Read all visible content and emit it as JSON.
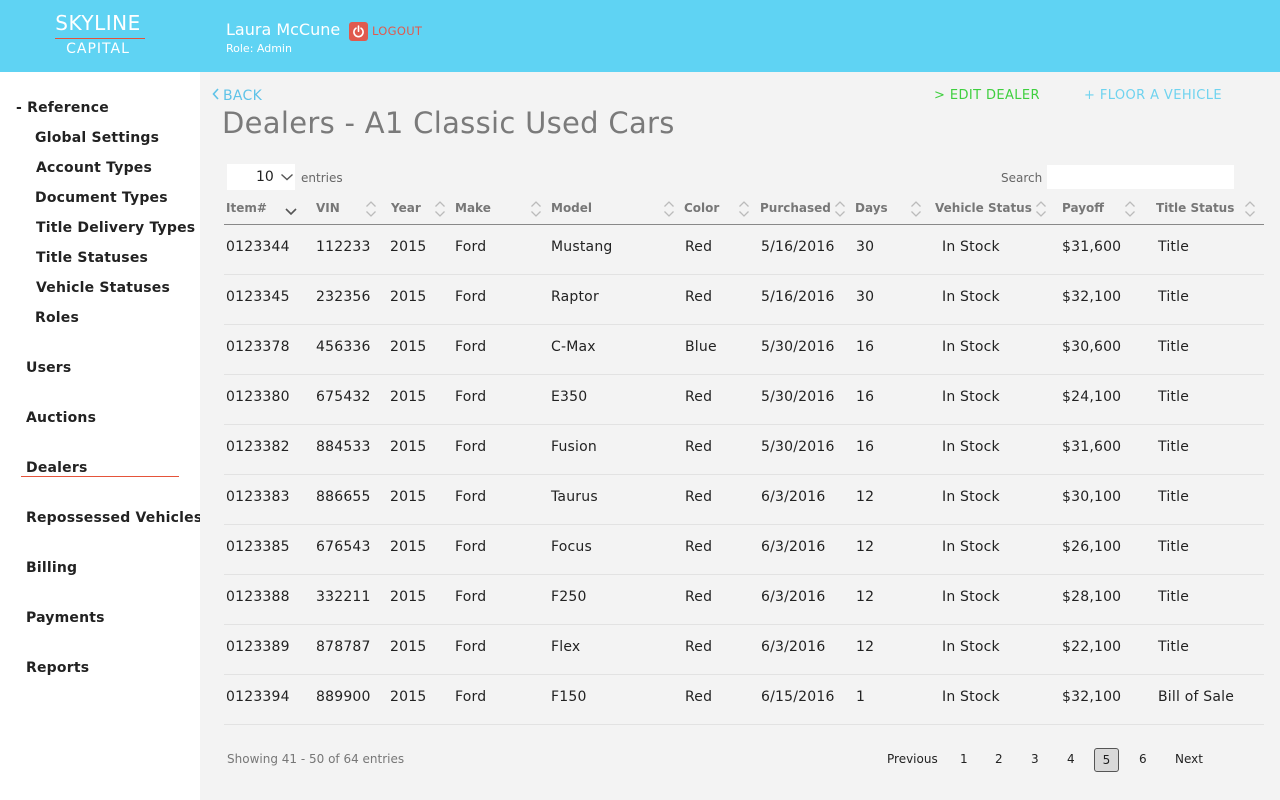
{
  "header": {
    "logo_top": "SKYLINE",
    "logo_bottom": "CAPITAL",
    "user_name": "Laura McCune",
    "user_role": "Role: Admin",
    "logout_label": "LOGOUT"
  },
  "sidebar": {
    "reference_label": "- Reference",
    "reference_items": [
      "Global Settings",
      "Account Types",
      "Document Types",
      "Title Delivery Types",
      "Title Statuses",
      "Vehicle Statuses",
      "Roles"
    ],
    "items": [
      "Users",
      "Auctions",
      "Dealers",
      "Repossessed Vehicles",
      "Billing",
      "Payments",
      "Reports"
    ],
    "active_item": "Dealers"
  },
  "main": {
    "back_label": "BACK",
    "edit_dealer_label": "> EDIT DEALER",
    "floor_vehicle_label": "+ FLOOR A VEHICLE",
    "title": "Dealers - A1 Classic Used Cars",
    "entries_value": "10",
    "entries_label": "entries",
    "search_label": "Search",
    "search_value": ""
  },
  "table": {
    "columns": [
      "Item#",
      "VIN",
      "Year",
      "Make",
      "Model",
      "Color",
      "Purchased",
      "Days",
      "Vehicle Status",
      "Payoff",
      "Title Status"
    ],
    "rows": [
      [
        "0123344",
        "112233",
        "2015",
        "Ford",
        "Mustang",
        "Red",
        "5/16/2016",
        "30",
        "In Stock",
        "$31,600",
        "Title"
      ],
      [
        "0123345",
        "232356",
        "2015",
        "Ford",
        "Raptor",
        "Red",
        "5/16/2016",
        "30",
        "In Stock",
        "$32,100",
        "Title"
      ],
      [
        "0123378",
        "456336",
        "2015",
        "Ford",
        "C-Max",
        "Blue",
        "5/30/2016",
        "16",
        "In Stock",
        "$30,600",
        "Title"
      ],
      [
        "0123380",
        "675432",
        "2015",
        "Ford",
        "E350",
        "Red",
        "5/30/2016",
        "16",
        "In Stock",
        "$24,100",
        "Title"
      ],
      [
        "0123382",
        "884533",
        "2015",
        "Ford",
        "Fusion",
        "Red",
        "5/30/2016",
        "16",
        "In Stock",
        "$31,600",
        "Title"
      ],
      [
        "0123383",
        "886655",
        "2015",
        "Ford",
        "Taurus",
        "Red",
        "6/3/2016",
        "12",
        "In Stock",
        "$30,100",
        "Title"
      ],
      [
        "0123385",
        "676543",
        "2015",
        "Ford",
        "Focus",
        "Red",
        "6/3/2016",
        "12",
        "In Stock",
        "$26,100",
        "Title"
      ],
      [
        "0123388",
        "332211",
        "2015",
        "Ford",
        "F250",
        "Red",
        "6/3/2016",
        "12",
        "In Stock",
        "$28,100",
        "Title"
      ],
      [
        "0123389",
        "878787",
        "2015",
        "Ford",
        "Flex",
        "Red",
        "6/3/2016",
        "12",
        "In Stock",
        "$22,100",
        "Title"
      ],
      [
        "0123394",
        "889900",
        "2015",
        "Ford",
        "F150",
        "Red",
        "6/15/2016",
        "1",
        "In Stock",
        "$32,100",
        "Bill of Sale"
      ]
    ]
  },
  "footer": {
    "showing": "Showing 41 - 50 of 64 entries",
    "previous": "Previous",
    "pages": [
      "1",
      "2",
      "3",
      "4",
      "5",
      "6"
    ],
    "current_page": "5",
    "next": "Next"
  },
  "colors": {
    "header_bg": "#5fd3f3",
    "accent_red": "#e5533a",
    "logout_red": "#e05a4e",
    "back_blue": "#5fc3e8",
    "edit_green": "#3fcf3f",
    "floor_blue": "#6fd3ef"
  },
  "icons": {
    "logout": "power-icon",
    "back": "chevron-left-icon",
    "select": "chevron-down-icon",
    "sort": "sort-icon",
    "sort_active": "sort-desc-icon"
  }
}
